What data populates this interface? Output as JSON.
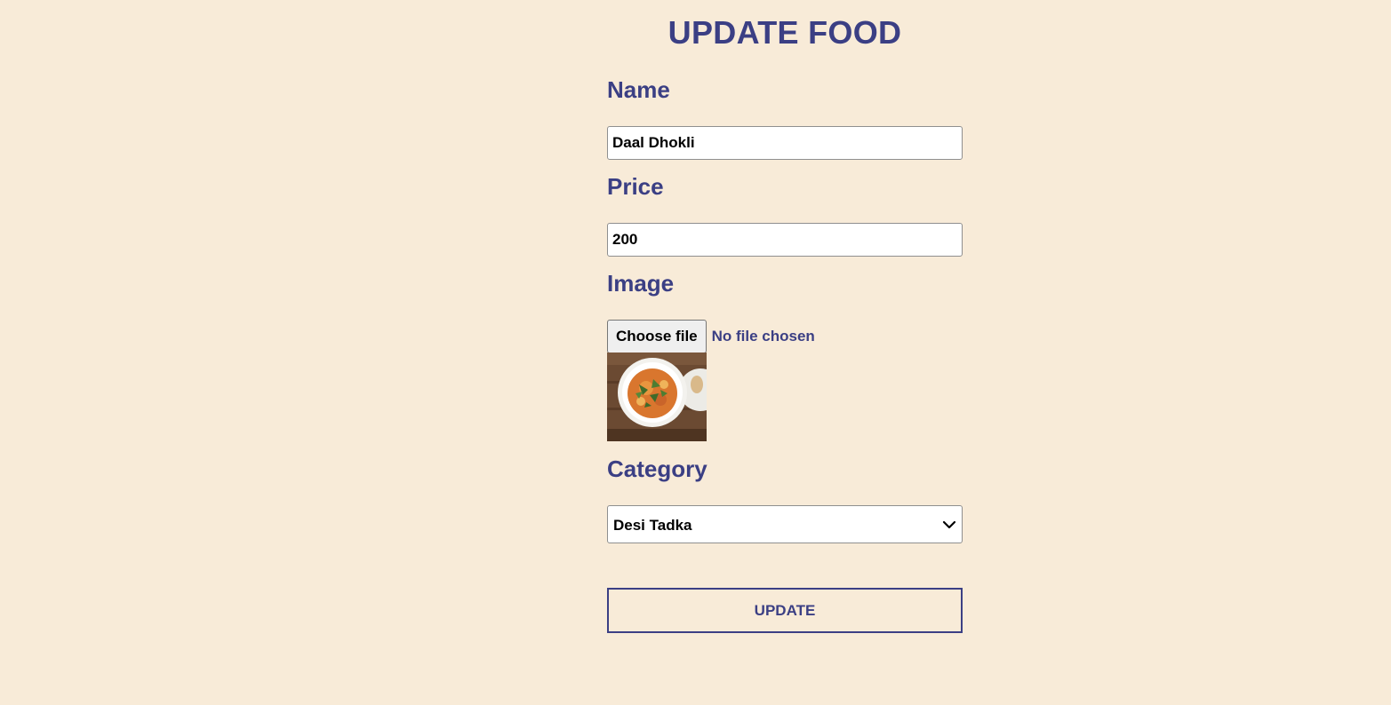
{
  "page": {
    "title": "UPDATE FOOD"
  },
  "form": {
    "name": {
      "label": "Name",
      "value": "Daal Dhokli"
    },
    "price": {
      "label": "Price",
      "value": "200"
    },
    "image": {
      "label": "Image",
      "button_label": "Choose file",
      "status_text": "No file chosen",
      "preview_icon": "food-bowl-photo"
    },
    "category": {
      "label": "Category",
      "selected": "Desi Tadka",
      "icon": "chevron-down-icon"
    },
    "submit_label": "UPDATE"
  },
  "colors": {
    "background": "#f8ebd8",
    "accent": "#3b3f84",
    "input_background": "#ffffff"
  }
}
